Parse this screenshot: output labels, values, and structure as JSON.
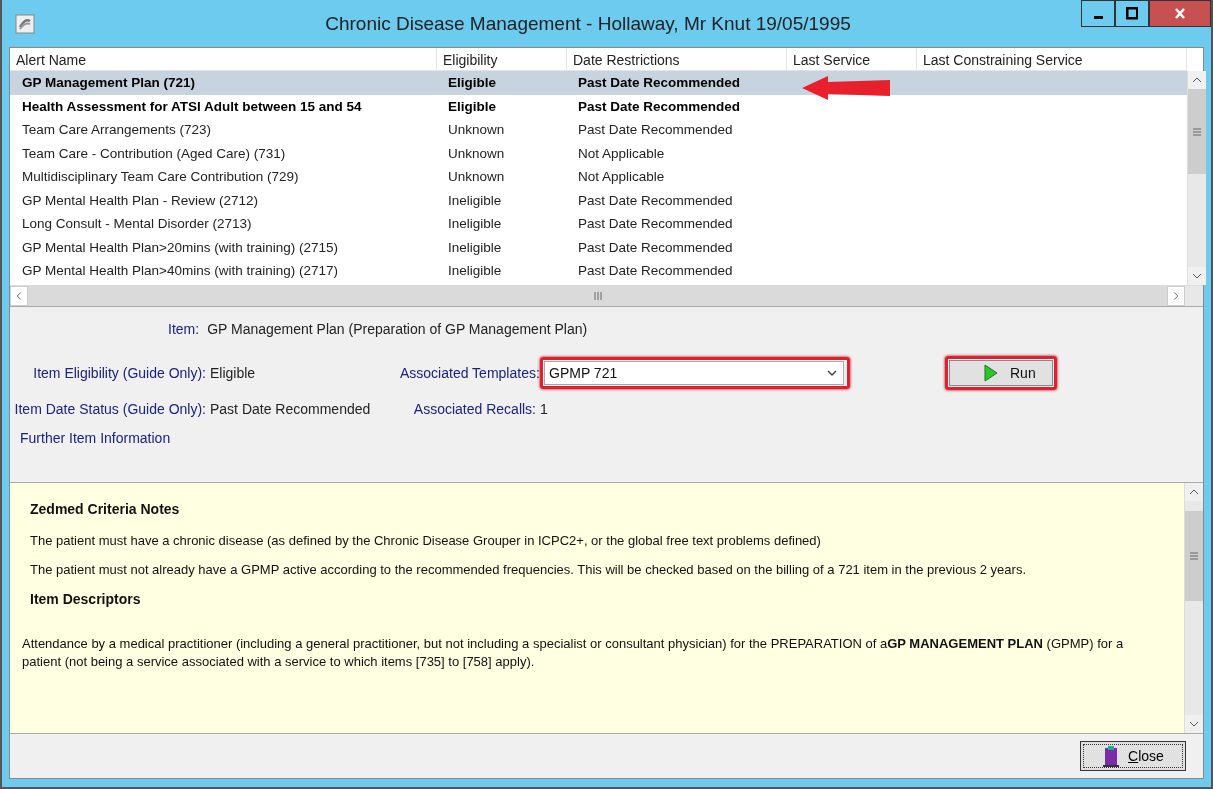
{
  "window": {
    "title": "Chronic Disease Management - Hollaway, Mr Knut 19/05/1995"
  },
  "table": {
    "columns": [
      "Alert Name",
      "Eligibility",
      "Date Restrictions",
      "Last Service",
      "Last Constraining Service"
    ],
    "rows": [
      {
        "cells": [
          "GP Management Plan (721)",
          "Eligible",
          "Past Date Recommended"
        ],
        "emphasized": true,
        "selected": true,
        "pointer_arrow": true
      },
      {
        "cells": [
          "Health Assessment for ATSI Adult between 15 and 54",
          "Eligible",
          "Past Date Recommended"
        ],
        "emphasized": true,
        "selected": false,
        "pointer_arrow": false
      },
      {
        "cells": [
          "Team Care Arrangements (723)",
          "Unknown",
          "Past Date Recommended"
        ],
        "emphasized": false,
        "selected": false,
        "pointer_arrow": false
      },
      {
        "cells": [
          "Team Care - Contribution (Aged Care) (731)",
          "Unknown",
          "Not Applicable"
        ],
        "emphasized": false,
        "selected": false,
        "pointer_arrow": false
      },
      {
        "cells": [
          "Multidisciplinary Team Care Contribution (729)",
          "Unknown",
          "Not Applicable"
        ],
        "emphasized": false,
        "selected": false,
        "pointer_arrow": false
      },
      {
        "cells": [
          "GP Mental Health Plan - Review (2712)",
          "Ineligible",
          "Past Date Recommended"
        ],
        "emphasized": false,
        "selected": false,
        "pointer_arrow": false
      },
      {
        "cells": [
          "Long Consult - Mental Disorder (2713)",
          "Ineligible",
          "Past Date Recommended"
        ],
        "emphasized": false,
        "selected": false,
        "pointer_arrow": false
      },
      {
        "cells": [
          "GP Mental Health Plan>20mins (with training) (2715)",
          "Ineligible",
          "Past Date Recommended"
        ],
        "emphasized": false,
        "selected": false,
        "pointer_arrow": false
      },
      {
        "cells": [
          "GP Mental Health Plan>40mins (with training) (2717)",
          "Ineligible",
          "Past Date Recommended"
        ],
        "emphasized": false,
        "selected": false,
        "pointer_arrow": false
      }
    ]
  },
  "details": {
    "item": {
      "label": "Item:",
      "value": "GP Management Plan (Preparation of GP Management Plan)"
    },
    "eligibility": {
      "label": "Item Eligibility (Guide Only):",
      "value": "Eligible"
    },
    "templates": {
      "label": "Associated Templates:",
      "value": "GPMP 721",
      "highlighted": true
    },
    "run_button": {
      "label": "Run",
      "highlighted": true
    },
    "date_status": {
      "label": "Item Date Status (Guide Only):",
      "value": "Past Date Recommended"
    },
    "recalls": {
      "label": "Associated Recalls:",
      "value": "1"
    },
    "further_info_label": "Further Item Information"
  },
  "info_panel": [
    {
      "kind": "heading",
      "text": "Zedmed Criteria Notes"
    },
    {
      "kind": "note",
      "text": "The patient must have a chronic disease (as defined by the Chronic Disease Grouper in ICPC2+, or the global free text problems defined)"
    },
    {
      "kind": "note",
      "text": "The patient must not already have a GPMP active according to the recommended frequencies. This will be checked based on the billing of a 721 item in the previous 2 years."
    },
    {
      "kind": "heading",
      "text": "Item Descriptors"
    },
    {
      "kind": "descriptor",
      "text": "Attendance by a medical practitioner (including a general practitioner, but not including a specialist or consultant physician) for the PREPARATION of a**GP MANAGEMENT PLAN** (GPMP) for a patient (not being a service associated with a service to which items [735] to [758] apply)."
    }
  ],
  "close_button": {
    "label": "Close"
  }
}
